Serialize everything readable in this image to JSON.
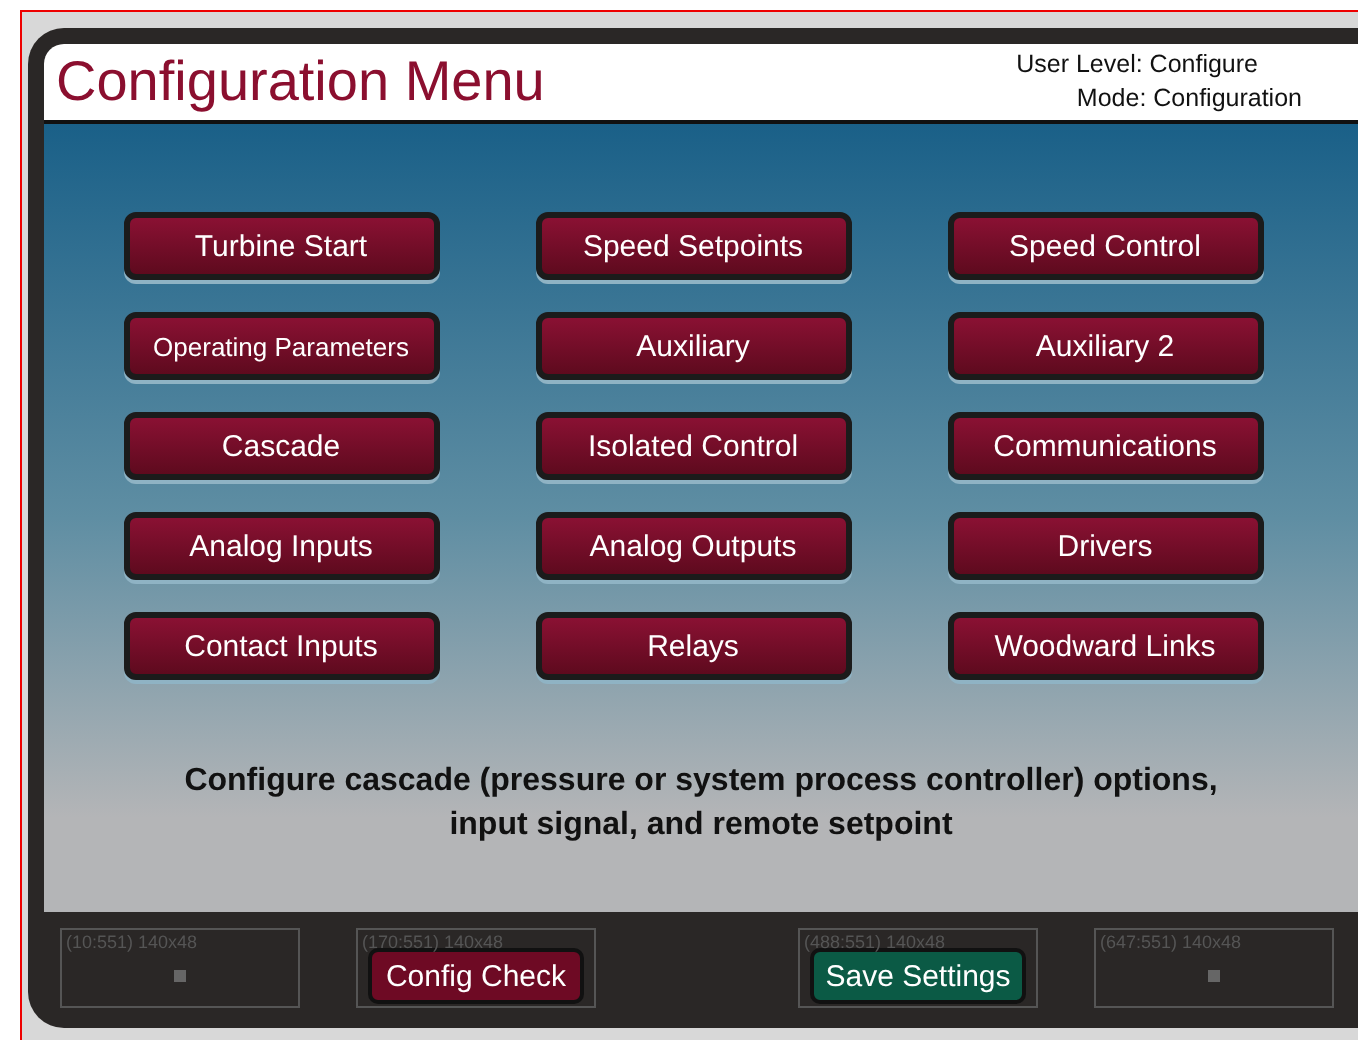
{
  "header": {
    "title": "Configuration Menu",
    "user_level": "User Level: Configure",
    "mode": "Mode: Configuration"
  },
  "menu_buttons": [
    {
      "label": "Turbine Start"
    },
    {
      "label": "Speed Setpoints"
    },
    {
      "label": "Speed Control"
    },
    {
      "label": "Operating Parameters"
    },
    {
      "label": "Auxiliary"
    },
    {
      "label": "Auxiliary 2"
    },
    {
      "label": "Cascade"
    },
    {
      "label": "Isolated Control"
    },
    {
      "label": "Communications"
    },
    {
      "label": "Analog Inputs"
    },
    {
      "label": "Analog Outputs"
    },
    {
      "label": "Drivers"
    },
    {
      "label": "Contact Inputs"
    },
    {
      "label": "Relays"
    },
    {
      "label": "Woodward Links"
    }
  ],
  "description": "Configure cascade (pressure or system process controller) options, input signal, and remote setpoint",
  "bottom_slots": [
    {
      "kind": "empty",
      "tag": "(10:551) 140x48"
    },
    {
      "kind": "button",
      "tag": "(170:551) 140x48",
      "label": "Config Check",
      "color": "#6e0a24"
    },
    {
      "kind": "spacer"
    },
    {
      "kind": "button",
      "tag": "(488:551) 140x48",
      "label": "Save Settings",
      "color": "#0b5a45"
    },
    {
      "kind": "empty",
      "tag": "(647:551) 140x48"
    }
  ]
}
